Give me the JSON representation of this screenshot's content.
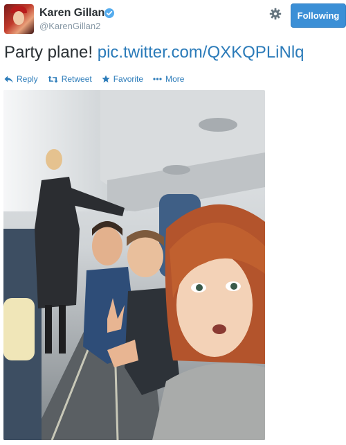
{
  "user": {
    "name": "Karen Gillan",
    "handle": "@KarenGillan2"
  },
  "header": {
    "follow_label": "Following"
  },
  "tweet": {
    "text": "Party plane! ",
    "link": "pic.twitter.com/QXKQPLiNlq"
  },
  "actions": {
    "reply": "Reply",
    "retweet": "Retweet",
    "favorite": "Favorite",
    "more": "More"
  },
  "colors": {
    "link": "#2b7bb9",
    "follow_button": "#3b8fd6",
    "verified": "#55acee"
  },
  "icons": [
    "verified-badge-icon",
    "gear-icon",
    "reply-icon",
    "retweet-icon",
    "star-icon",
    "more-dots-icon"
  ]
}
